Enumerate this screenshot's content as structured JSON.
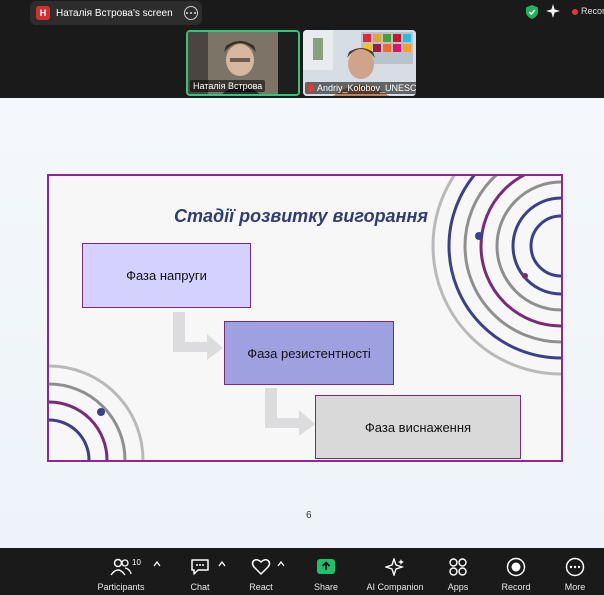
{
  "topbar": {
    "share_badge": "H",
    "share_label": "Наталія Встрова's screen",
    "recording_label": "Recording"
  },
  "participants_strip": [
    {
      "name": "Наталія Встрова"
    },
    {
      "name": "Andriy_Kolobov_UNESCO"
    }
  ],
  "slide": {
    "title": "Стадії розвитку вигорання",
    "stages": [
      "Фаза напруги",
      "Фаза резистентності",
      "Фаза виснаження"
    ],
    "page_number": "6",
    "colors": {
      "border": "#8e2a8e",
      "stage1": "#d4d1ff",
      "stage2": "#9ea0e0",
      "stage3": "#d9d9d9",
      "title": "#2f3d76"
    }
  },
  "toolbar": {
    "participants_label": "Participants",
    "participants_count": "10",
    "chat_label": "Chat",
    "react_label": "React",
    "share_label": "Share",
    "ai_label": "AI Companion",
    "apps_label": "Apps",
    "record_label": "Record",
    "more_label": "More",
    "share_color": "#1fbf6b"
  }
}
